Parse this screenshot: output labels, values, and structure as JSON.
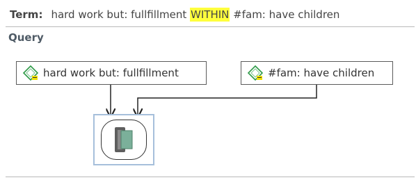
{
  "term": {
    "label": "Term:",
    "value_prefix": "hard work but: fullfillment ",
    "value_highlight": "WITHIN",
    "value_suffix": " #fam: have children"
  },
  "query": {
    "title": "Query",
    "nodes": [
      {
        "label": "hard work but: fullfillment",
        "icon": "code-tag-icon"
      },
      {
        "label": "#fam: have children",
        "icon": "code-tag-icon"
      }
    ],
    "operator": {
      "name": "within-operator",
      "icon": "within-icon"
    }
  },
  "colors": {
    "highlight": "#ffff3d",
    "selection_frame": "#a6bfdb",
    "icon_green": "#2e9a47",
    "icon_yellow": "#f0e000",
    "within_dark": "#5e5e5e",
    "within_teal": "#7bb09a"
  }
}
